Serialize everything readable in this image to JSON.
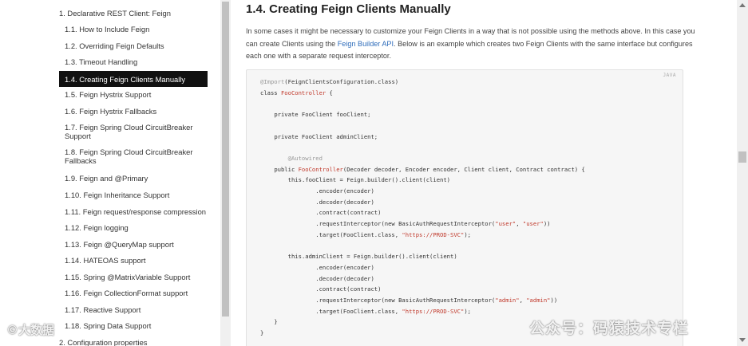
{
  "sidebar": {
    "items": [
      {
        "label": "1. Declarative REST Client: Feign",
        "level": "top"
      },
      {
        "label": "1.1. How to Include Feign"
      },
      {
        "label": "1.2. Overriding Feign Defaults"
      },
      {
        "label": "1.3. Timeout Handling"
      },
      {
        "label": "1.4. Creating Feign Clients Manually",
        "active": true
      },
      {
        "label": "1.5. Feign Hystrix Support"
      },
      {
        "label": "1.6. Feign Hystrix Fallbacks"
      },
      {
        "label": "1.7. Feign Spring Cloud CircuitBreaker Support"
      },
      {
        "label": "1.8. Feign Spring Cloud CircuitBreaker Fallbacks"
      },
      {
        "label": "1.9. Feign and @Primary"
      },
      {
        "label": "1.10. Feign Inheritance Support"
      },
      {
        "label": "1.11. Feign request/response compression"
      },
      {
        "label": "1.12. Feign logging"
      },
      {
        "label": "1.13. Feign @QueryMap support"
      },
      {
        "label": "1.14. HATEOAS support"
      },
      {
        "label": "1.15. Spring @MatrixVariable Support"
      },
      {
        "label": "1.16. Feign CollectionFormat support"
      },
      {
        "label": "1.17. Reactive Support"
      },
      {
        "label": "1.18. Spring Data Support"
      },
      {
        "label": "2. Configuration properties",
        "level": "top"
      }
    ]
  },
  "content": {
    "heading": "1.4. Creating Feign Clients Manually",
    "intro_before_link": "In some cases it might be necessary to customize your Feign Clients in a way that is not possible using the methods above. In this case you can create Clients using the ",
    "intro_link": "Feign Builder API",
    "intro_after_link": ". Below is an example which creates two Feign Clients with the same interface but configures each one with a separate request interceptor.",
    "code_language": "JAVA"
  },
  "watermarks": {
    "left": "©大数据",
    "right": "公众号：码猿技术专栏"
  },
  "colors": {
    "active_bg": "#111111",
    "link": "#2f6dbb",
    "code_bg": "#f6f6f6"
  }
}
